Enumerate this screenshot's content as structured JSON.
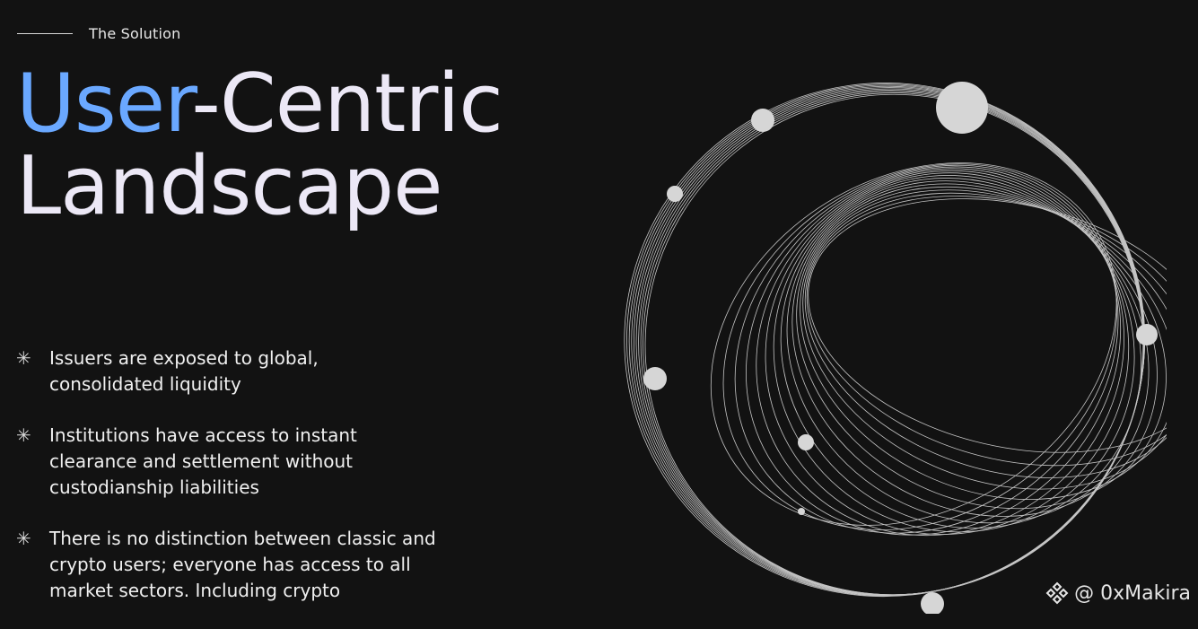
{
  "section": {
    "eyebrow": "The Solution"
  },
  "headline": {
    "accent": "User",
    "rest_line1": "-Centric",
    "line2": "Landscape"
  },
  "bullets": [
    {
      "lines": [
        "Issuers are exposed to global,",
        "consolidated liquidity"
      ]
    },
    {
      "lines": [
        "Institutions have access to instant",
        "clearance and settlement without",
        "custodianship liabilities"
      ]
    },
    {
      "lines": [
        "There is no distinction between classic and",
        "crypto users; everyone has access to all",
        "market sectors. Including crypto"
      ]
    }
  ],
  "watermark": {
    "text": "@ 0xMakira"
  },
  "colors": {
    "background": "#121212",
    "accent": "#6aa8ff",
    "text": "#ece8f6"
  }
}
